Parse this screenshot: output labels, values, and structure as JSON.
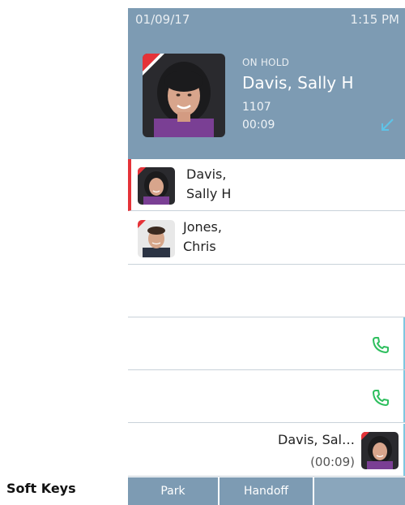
{
  "status_bar": {
    "date": "01/09/17",
    "time": "1:15 PM"
  },
  "hold_panel": {
    "state": "ON HOLD",
    "name": "Davis, Sally H",
    "extension": "1107",
    "timer": "00:09",
    "arrow_icon": "incoming-call-arrow-icon"
  },
  "lines": [
    {
      "line1": "Davis,",
      "line2": "Sally H",
      "active": true
    },
    {
      "line1": "Jones,",
      "line2": "Chris",
      "active": false
    }
  ],
  "call_appearances": [
    {
      "icon": "phone-icon"
    },
    {
      "icon": "phone-icon"
    }
  ],
  "current_call": {
    "name": "Davis, Sal…",
    "duration": "(00:09)"
  },
  "softkeys": [
    "Park",
    "Handoff",
    ""
  ],
  "softkeys_label": "Soft Keys",
  "colors": {
    "accent": "#7d9bb3",
    "hold_marker": "#e53238",
    "phone_icon": "#2fbf5f"
  }
}
